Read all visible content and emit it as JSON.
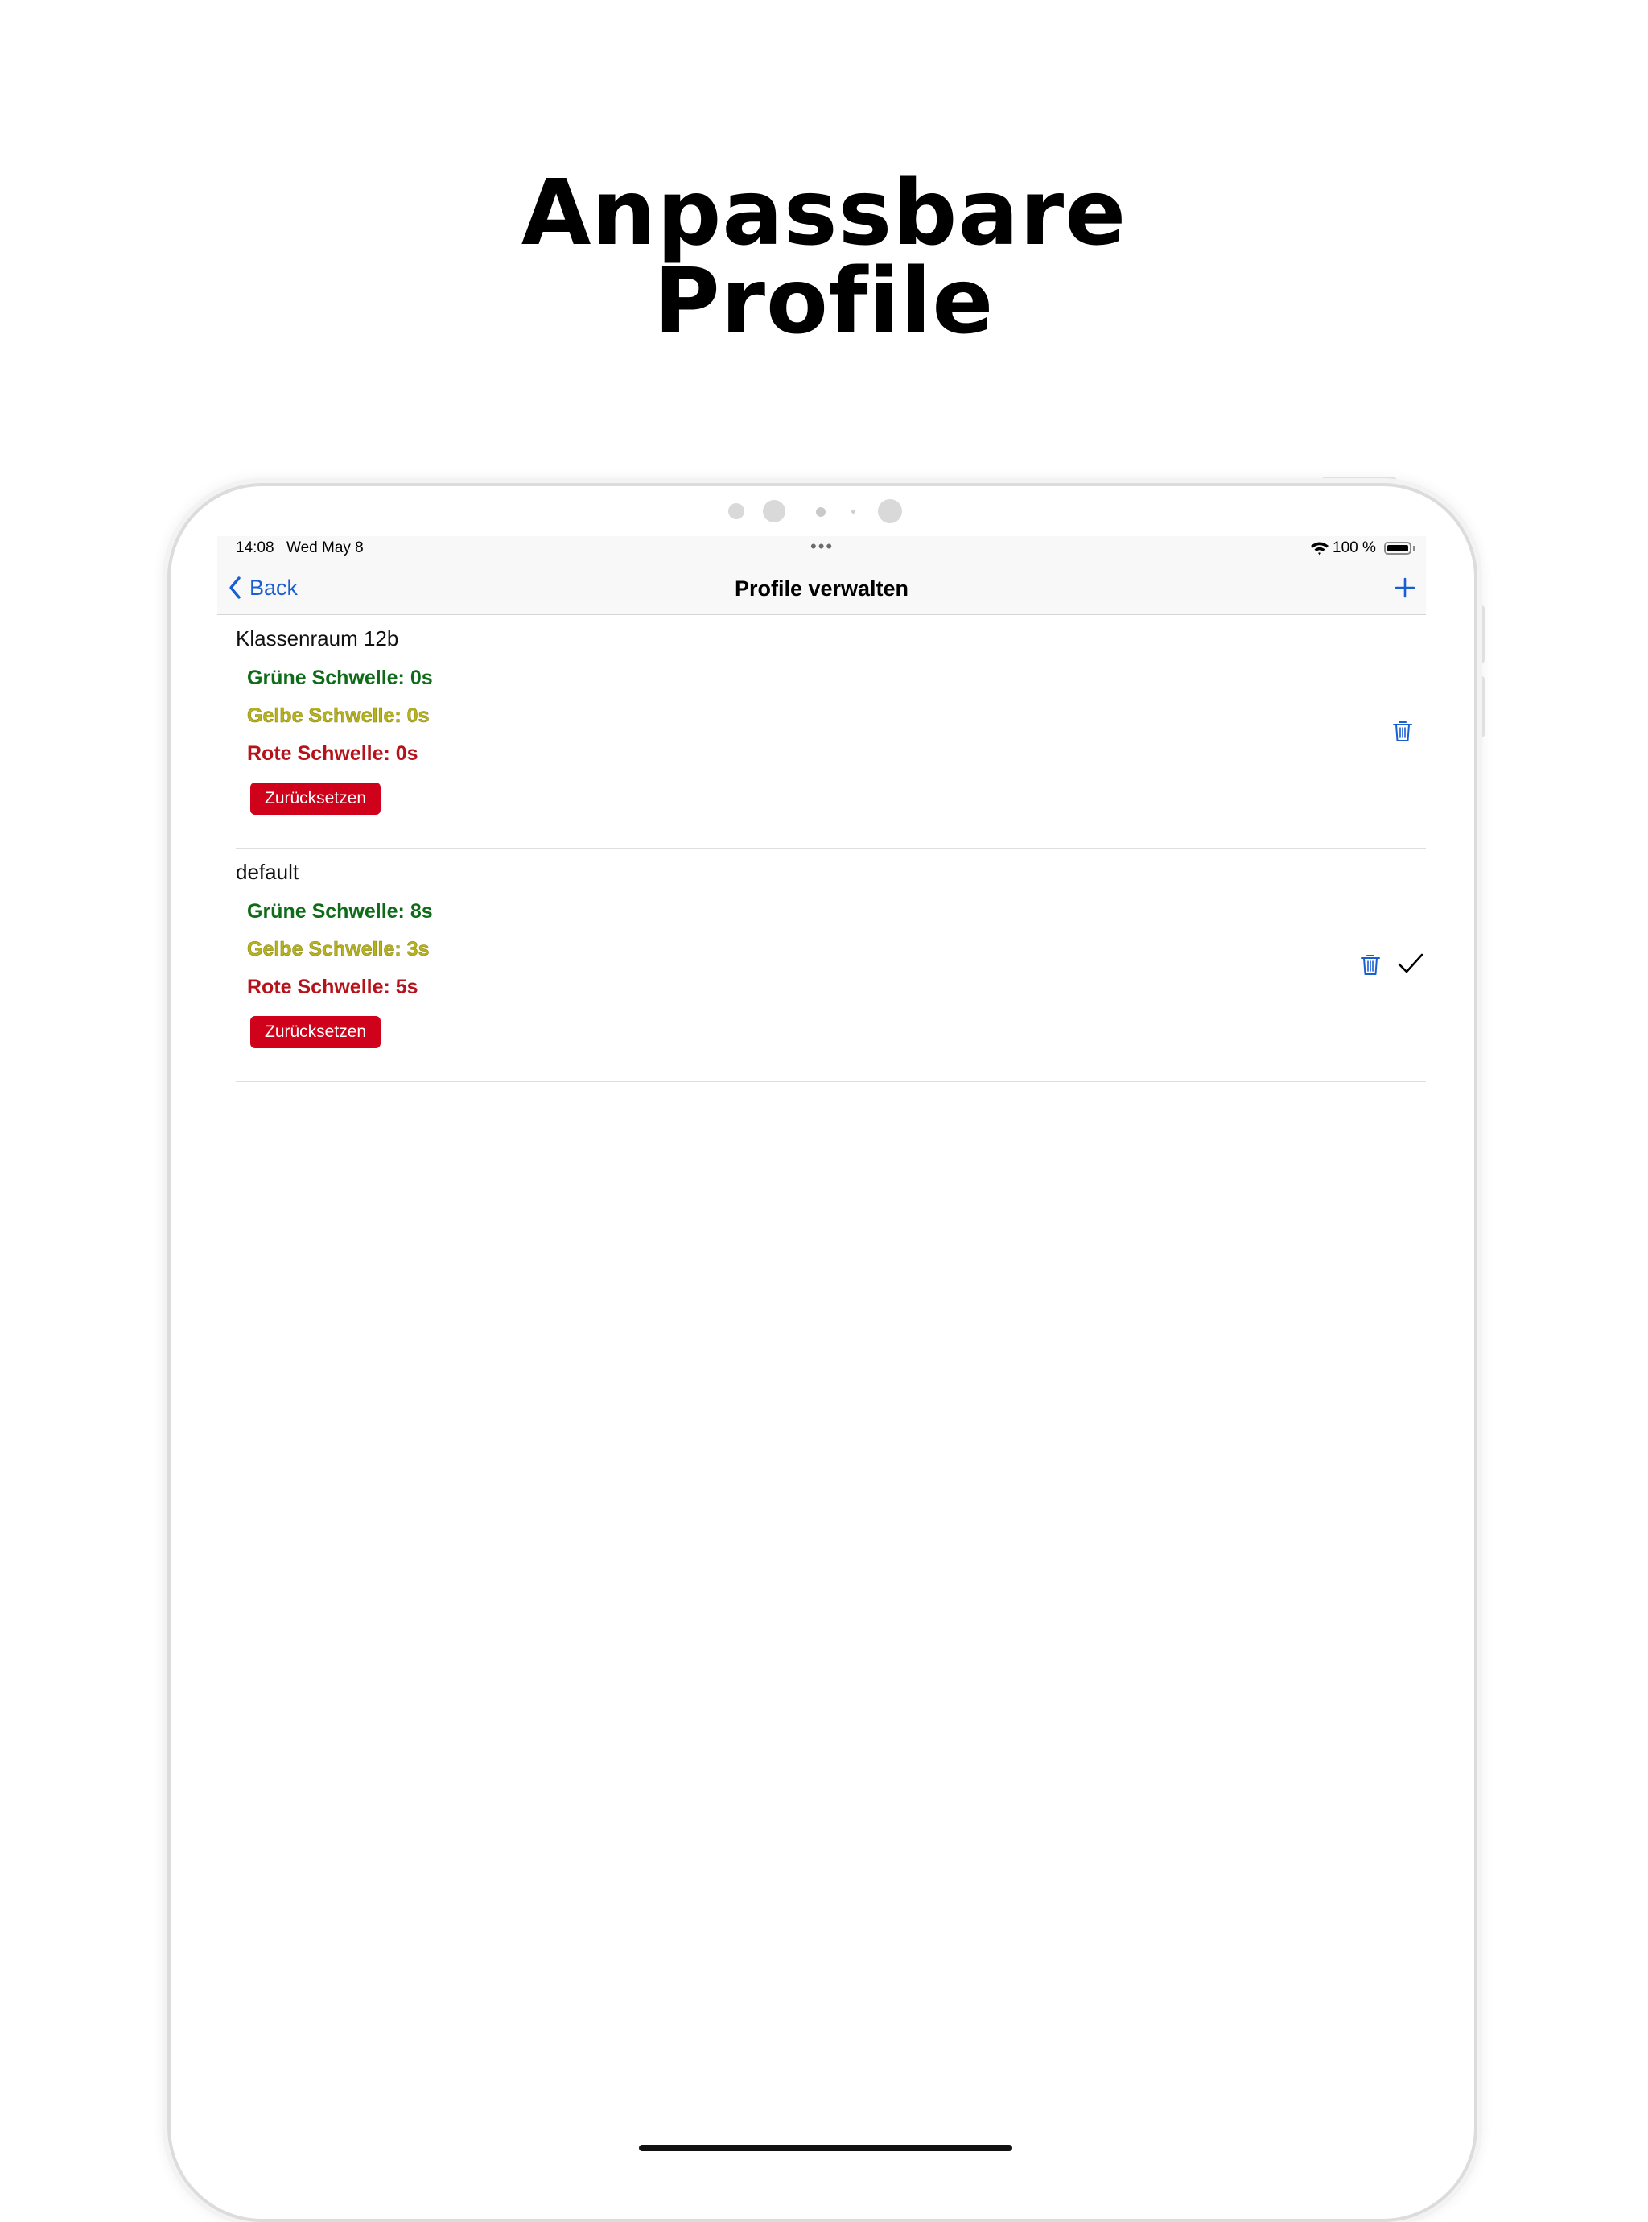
{
  "headline": {
    "line1": "Anpassbare",
    "line2": "Profile"
  },
  "status_bar": {
    "time": "14:08",
    "date": "Wed May 8",
    "battery": "100 %"
  },
  "nav": {
    "back_label": "Back",
    "title": "Profile verwalten",
    "add_icon": "plus-icon",
    "back_icon": "chevron-left-icon"
  },
  "profiles": [
    {
      "name": "Klassenraum 12b",
      "green": "Grüne Schwelle: 0s",
      "yellow": "Gelbe Schwelle: 0s",
      "red": "Rote Schwelle: 0s",
      "reset_label": "Zurücksetzen",
      "selected": false
    },
    {
      "name": "default",
      "green": "Grüne Schwelle: 8s",
      "yellow": "Gelbe Schwelle: 3s",
      "red": "Rote Schwelle: 5s",
      "reset_label": "Zurücksetzen",
      "selected": true
    }
  ],
  "colors": {
    "accent": "#1a5fd1",
    "green_threshold": "#0e6b17",
    "yellow_threshold": "#b8b21c",
    "red_threshold": "#b5121a",
    "reset_button": "#d0021b"
  }
}
